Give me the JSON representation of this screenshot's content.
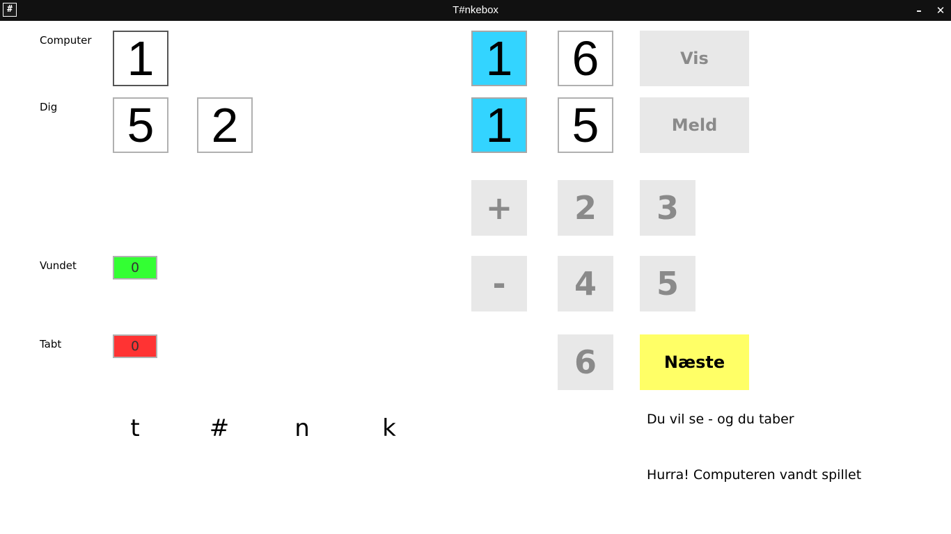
{
  "window": {
    "title": "T#nkebox",
    "icon": "#",
    "minimize": "–",
    "close": "✕"
  },
  "players": {
    "computer_label": "Computer",
    "you_label": "Dig"
  },
  "computer_dice": [
    "1"
  ],
  "your_dice": [
    "5",
    "2"
  ],
  "selected_dice": {
    "row1": "1",
    "row2": "1"
  },
  "current_dice": {
    "row1": "6",
    "row2": "5"
  },
  "actions": {
    "show": "Vis",
    "call": "Meld",
    "next": "Næste"
  },
  "keypad": {
    "plus": "+",
    "minus": "-",
    "k2": "2",
    "k3": "3",
    "k4": "4",
    "k5": "5",
    "k6": "6"
  },
  "score": {
    "won_label": "Vundet",
    "won_value": "0",
    "lost_label": "Tabt",
    "lost_value": "0"
  },
  "letters": [
    "t",
    "#",
    "n",
    "k"
  ],
  "messages": {
    "line1": "Du vil se - og du taber",
    "line2": "Hurra! Computeren vandt spillet"
  },
  "colors": {
    "selected": "#33d4ff",
    "won": "#33ff33",
    "lost": "#ff3333",
    "next": "#ffff66",
    "button_bg": "#e8e8e8"
  }
}
